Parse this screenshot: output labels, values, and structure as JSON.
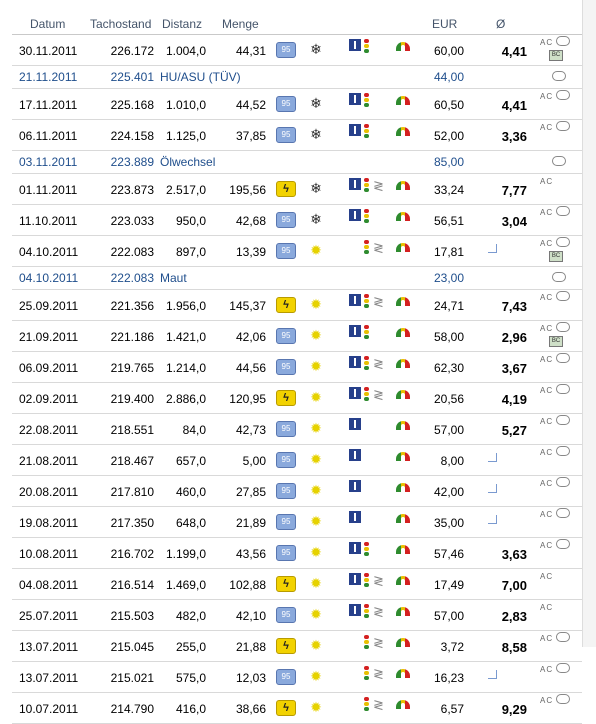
{
  "header": {
    "datum": "Datum",
    "tachostand": "Tachostand",
    "distanz": "Distanz",
    "menge": "Menge",
    "eur": "EUR",
    "avg": "Ø"
  },
  "rows": [
    {
      "type": "entry",
      "date": "30.11.2011",
      "tacho": "226.172",
      "dist": "1.004,0",
      "menge": "44,31",
      "fuel": "95",
      "season": "snow",
      "road": [
        "highway",
        "light"
      ],
      "eur": "60,00",
      "avg": "4,41",
      "meta": [
        "ac",
        "bubble",
        "bc"
      ]
    },
    {
      "type": "note",
      "date": "21.11.2011",
      "tacho": "225.401",
      "text": "HU/ASU (TÜV)",
      "eur": "44,00",
      "meta": [
        "bubble"
      ]
    },
    {
      "type": "entry",
      "date": "17.11.2011",
      "tacho": "225.168",
      "dist": "1.010,0",
      "menge": "44,52",
      "fuel": "95",
      "season": "snow",
      "road": [
        "highway",
        "light"
      ],
      "eur": "60,50",
      "avg": "4,41",
      "meta": [
        "ac",
        "bubble"
      ]
    },
    {
      "type": "entry",
      "date": "06.11.2011",
      "tacho": "224.158",
      "dist": "1.125,0",
      "menge": "37,85",
      "fuel": "95",
      "season": "snow",
      "road": [
        "highway",
        "light"
      ],
      "eur": "52,00",
      "avg": "3,36",
      "meta": [
        "ac",
        "bubble"
      ]
    },
    {
      "type": "note",
      "date": "03.11.2011",
      "tacho": "223.889",
      "text": "Ölwechsel",
      "eur": "85,00",
      "meta": [
        "bubble"
      ]
    },
    {
      "type": "entry",
      "date": "01.11.2011",
      "tacho": "223.873",
      "dist": "2.517,0",
      "menge": "195,56",
      "fuel": "E",
      "season": "snow",
      "road": [
        "highway",
        "light",
        "curve"
      ],
      "eur": "33,24",
      "avg": "7,77",
      "meta": [
        "ac"
      ]
    },
    {
      "type": "entry",
      "date": "11.10.2011",
      "tacho": "223.033",
      "dist": "950,0",
      "menge": "42,68",
      "fuel": "95",
      "season": "snow",
      "road": [
        "highway",
        "light"
      ],
      "eur": "56,51",
      "avg": "3,04",
      "meta": [
        "ac",
        "bubble"
      ]
    },
    {
      "type": "entry",
      "date": "04.10.2011",
      "tacho": "222.083",
      "dist": "897,0",
      "menge": "13,39",
      "fuel": "95",
      "season": "sun",
      "road": [
        "light",
        "curve"
      ],
      "eur": "17,81",
      "avg": "",
      "ret": true,
      "meta": [
        "ac",
        "bubble",
        "bc"
      ]
    },
    {
      "type": "note",
      "date": "04.10.2011",
      "tacho": "222.083",
      "text": "Maut",
      "eur": "23,00",
      "meta": [
        "bubble"
      ]
    },
    {
      "type": "entry",
      "date": "25.09.2011",
      "tacho": "221.356",
      "dist": "1.956,0",
      "menge": "145,37",
      "fuel": "E",
      "season": "sun",
      "road": [
        "highway",
        "light",
        "curve"
      ],
      "eur": "24,71",
      "avg": "7,43",
      "meta": [
        "ac",
        "bubble"
      ]
    },
    {
      "type": "entry",
      "date": "21.09.2011",
      "tacho": "221.186",
      "dist": "1.421,0",
      "menge": "42,06",
      "fuel": "95",
      "season": "sun",
      "road": [
        "highway",
        "light"
      ],
      "eur": "58,00",
      "avg": "2,96",
      "meta": [
        "ac",
        "bubble",
        "bc"
      ]
    },
    {
      "type": "entry",
      "date": "06.09.2011",
      "tacho": "219.765",
      "dist": "1.214,0",
      "menge": "44,56",
      "fuel": "95",
      "season": "sun",
      "road": [
        "highway",
        "light",
        "curve"
      ],
      "eur": "62,30",
      "avg": "3,67",
      "meta": [
        "ac",
        "bubble"
      ]
    },
    {
      "type": "entry",
      "date": "02.09.2011",
      "tacho": "219.400",
      "dist": "2.886,0",
      "menge": "120,95",
      "fuel": "E",
      "season": "sun",
      "road": [
        "highway",
        "light",
        "curve"
      ],
      "eur": "20,56",
      "avg": "4,19",
      "meta": [
        "ac",
        "bubble"
      ]
    },
    {
      "type": "entry",
      "date": "22.08.2011",
      "tacho": "218.551",
      "dist": "84,0",
      "menge": "42,73",
      "fuel": "95",
      "season": "sun",
      "road": [
        "highway"
      ],
      "eur": "57,00",
      "avg": "5,27",
      "meta": [
        "ac",
        "bubble"
      ]
    },
    {
      "type": "entry",
      "date": "21.08.2011",
      "tacho": "218.467",
      "dist": "657,0",
      "menge": "5,00",
      "fuel": "95",
      "season": "sun",
      "road": [
        "highway"
      ],
      "eur": "8,00",
      "avg": "",
      "ret": true,
      "meta": [
        "ac",
        "bubble"
      ]
    },
    {
      "type": "entry",
      "date": "20.08.2011",
      "tacho": "217.810",
      "dist": "460,0",
      "menge": "27,85",
      "fuel": "95",
      "season": "sun",
      "road": [
        "highway"
      ],
      "eur": "42,00",
      "avg": "",
      "ret": true,
      "meta": [
        "ac",
        "bubble"
      ]
    },
    {
      "type": "entry",
      "date": "19.08.2011",
      "tacho": "217.350",
      "dist": "648,0",
      "menge": "21,89",
      "fuel": "95",
      "season": "sun",
      "road": [
        "highway"
      ],
      "eur": "35,00",
      "avg": "",
      "ret": true,
      "meta": [
        "ac",
        "bubble"
      ]
    },
    {
      "type": "entry",
      "date": "10.08.2011",
      "tacho": "216.702",
      "dist": "1.199,0",
      "menge": "43,56",
      "fuel": "95",
      "season": "sun",
      "road": [
        "highway",
        "light"
      ],
      "eur": "57,46",
      "avg": "3,63",
      "meta": [
        "ac",
        "bubble"
      ]
    },
    {
      "type": "entry",
      "date": "04.08.2011",
      "tacho": "216.514",
      "dist": "1.469,0",
      "menge": "102,88",
      "fuel": "E",
      "season": "sun",
      "road": [
        "highway",
        "light",
        "curve"
      ],
      "eur": "17,49",
      "avg": "7,00",
      "meta": [
        "ac"
      ]
    },
    {
      "type": "entry",
      "date": "25.07.2011",
      "tacho": "215.503",
      "dist": "482,0",
      "menge": "42,10",
      "fuel": "95",
      "season": "sun",
      "road": [
        "highway",
        "light",
        "curve"
      ],
      "eur": "57,00",
      "avg": "2,83",
      "meta": [
        "ac"
      ]
    },
    {
      "type": "entry",
      "date": "13.07.2011",
      "tacho": "215.045",
      "dist": "255,0",
      "menge": "21,88",
      "fuel": "E",
      "season": "sun",
      "road": [
        "light",
        "curve"
      ],
      "eur": "3,72",
      "avg": "8,58",
      "meta": [
        "ac",
        "bubble"
      ]
    },
    {
      "type": "entry",
      "date": "13.07.2011",
      "tacho": "215.021",
      "dist": "575,0",
      "menge": "12,03",
      "fuel": "95",
      "season": "sun",
      "road": [
        "light",
        "curve"
      ],
      "eur": "16,23",
      "avg": "",
      "ret": true,
      "meta": [
        "ac",
        "bubble"
      ]
    },
    {
      "type": "entry",
      "date": "10.07.2011",
      "tacho": "214.790",
      "dist": "416,0",
      "menge": "38,66",
      "fuel": "E",
      "season": "sun",
      "road": [
        "light",
        "curve"
      ],
      "eur": "6,57",
      "avg": "9,29",
      "meta": [
        "ac",
        "bubble"
      ]
    }
  ],
  "labels": {
    "ac": "AC",
    "bc": "BC",
    "fuel95": "95",
    "fuelE": "ϟ",
    "snow": "❄",
    "sun": "✹",
    "curve": "≷"
  }
}
